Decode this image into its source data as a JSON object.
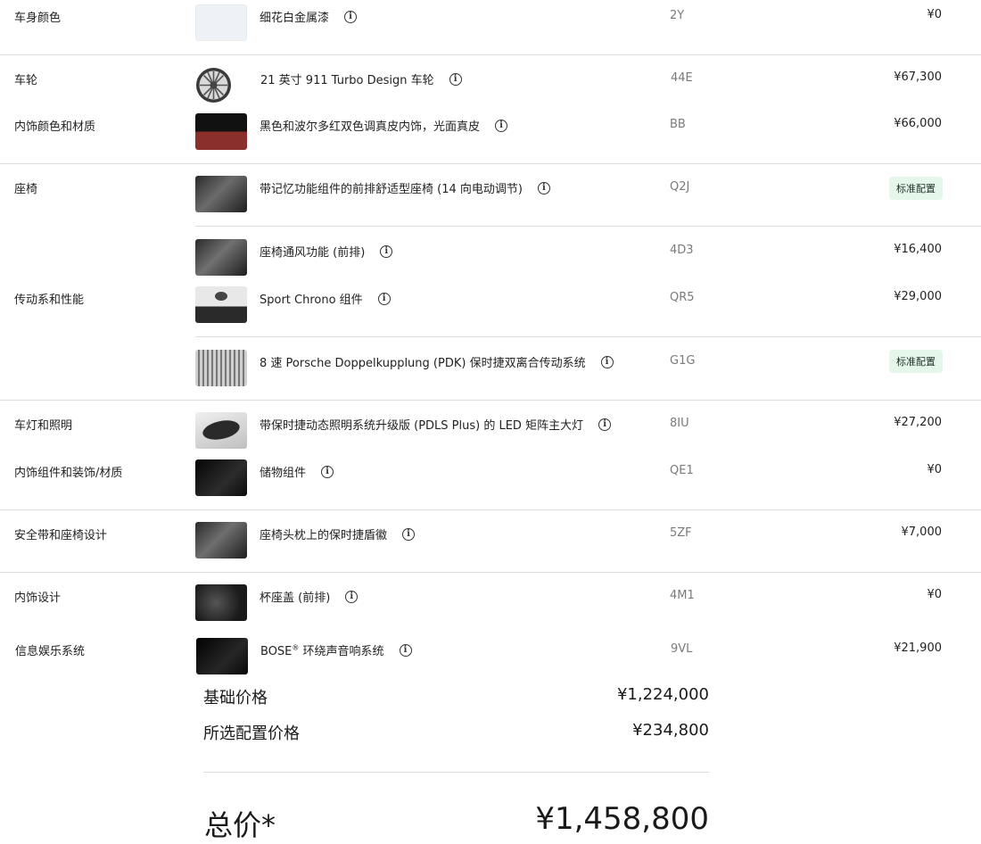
{
  "rows": [
    {
      "category": "车身颜色",
      "name": "细花白金属漆",
      "code": "2Y",
      "price": "¥0"
    },
    {
      "category": "车轮",
      "name": "21 英寸 911 Turbo Design 车轮",
      "code": "44E",
      "price": "¥67,300"
    },
    {
      "category": "内饰颜色和材质",
      "name": "黑色和波尔多红双色调真皮内饰，光面真皮",
      "code": "BB",
      "price": "¥66,000"
    },
    {
      "category": "座椅",
      "name": "带记忆功能组件的前排舒适型座椅 (14 向电动调节)",
      "code": "Q2J",
      "price": "标准配置"
    },
    {
      "category": "",
      "name": "座椅通风功能 (前排)",
      "code": "4D3",
      "price": "¥16,400"
    },
    {
      "category": "传动系和性能",
      "name": "Sport Chrono 组件",
      "code": "QR5",
      "price": "¥29,000"
    },
    {
      "category": "",
      "name": "8 速 Porsche Doppelkupplung (PDK) 保时捷双离合传动系统",
      "code": "G1G",
      "price": "标准配置"
    },
    {
      "category": "车灯和照明",
      "name": "带保时捷动态照明系统升级版 (PDLS Plus) 的 LED 矩阵主大灯",
      "code": "8IU",
      "price": "¥27,200"
    },
    {
      "category": "内饰组件和装饰/材质",
      "name": "储物组件",
      "code": "QE1",
      "price": "¥0"
    },
    {
      "category": "安全带和座椅设计",
      "name": "座椅头枕上的保时捷盾徽",
      "code": "5ZF",
      "price": "¥7,000"
    },
    {
      "category": "内饰设计",
      "name": "杯座盖 (前排)",
      "code": "4M1",
      "price": "¥0"
    },
    {
      "category": "信息娱乐系统",
      "name_main": "BOSE",
      "name_sup": "®",
      "name_rest": " 环绕声音响系统",
      "code": "9VL",
      "price": "¥21,900"
    }
  ],
  "summary": {
    "base_label": "基础价格",
    "base_value": "¥1,224,000",
    "options_label": "所选配置价格",
    "options_value": "¥234,800",
    "total_label": "总价*",
    "total_value": "¥1,458,800"
  },
  "icons": {
    "info": "info-circle-icon"
  },
  "colors": {
    "badge_bg": "#e5f6ea",
    "divider": "#dcdcdc",
    "code_text": "#7a7a7a"
  }
}
